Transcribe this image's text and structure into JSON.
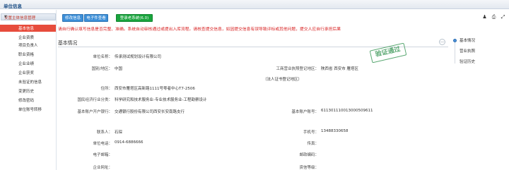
{
  "topbar": {
    "title": "单位信息"
  },
  "sidebar": {
    "group_label": "安置主体信息管理",
    "items": [
      {
        "label": "基本信息",
        "active": true
      },
      {
        "label": "企业资质",
        "active": false
      },
      {
        "label": "项目负责人",
        "active": false
      },
      {
        "label": "职业资格",
        "active": false
      },
      {
        "label": "企业业绩",
        "active": false
      },
      {
        "label": "企业获奖",
        "active": false
      },
      {
        "label": "未验证的信息",
        "active": false
      },
      {
        "label": "变更历史",
        "active": false
      },
      {
        "label": "修改密码",
        "active": false
      },
      {
        "label": "单位账号转移",
        "active": false
      }
    ]
  },
  "toolbar": {
    "edit_label": "修改信息",
    "eview_label": "电子件查看",
    "login_label": "登录老系统(6.0)"
  },
  "warning_text": "请自行确认填写信息是否完整、准确。系统自动审核通过或提出入库流程。请核查提交信息，如因提交信息有误导致评标或其他问题，提交人应自行承担后果",
  "section": {
    "title": "基本情况",
    "collapse_symbol": "—"
  },
  "stamp_text": "验证通过",
  "fields": {
    "unit_name": {
      "label": "单位名称：",
      "value": "传承测试规划设计有限公司"
    },
    "country": {
      "label": "国别/地区：",
      "value": "中国"
    },
    "reg_addr": {
      "label": "工商营业执照登记地区：",
      "value": "陕西省 西安市 雁塔区"
    },
    "reg_addr_note": {
      "value": "（法人证书登记地区）"
    },
    "address": {
      "label": "住所：",
      "value": "西安市雁塔区高新路1111号零者中心T7-2506"
    },
    "industry": {
      "label": "国民经济行业分类：",
      "value": "科学研究和技术服务业-专业技术服务业-工程勘察设计"
    },
    "bank": {
      "label": "基本账户开户银行：",
      "value": "交通银行股份有限公司西安长安南路支行"
    },
    "account": {
      "label": "基本账户账号：",
      "value": "611301110013000509611"
    },
    "contact": {
      "label": "联系人：",
      "value": "石琛"
    },
    "mobile": {
      "label": "手机号：",
      "value": "13488330658"
    },
    "phone": {
      "label": "单位电话：",
      "value": "0914-6886666"
    },
    "fax": {
      "label": "传真：",
      "value": ""
    },
    "email": {
      "label": "电子邮箱：",
      "value": ""
    },
    "postcode": {
      "label": "邮政编码：",
      "value": ""
    },
    "website": {
      "label": "企业网址：",
      "value": ""
    },
    "service": {
      "label": "资信等级：",
      "value": ""
    }
  },
  "right_nav": [
    {
      "label": "基本情况"
    },
    {
      "label": "营业执照"
    },
    {
      "label": "验证历史"
    }
  ],
  "colors": {
    "accent_red": "#e74c3c",
    "button_blue": "#3c8fd8",
    "button_green": "#19a43d",
    "stamp_green": "#3f9a5b"
  }
}
